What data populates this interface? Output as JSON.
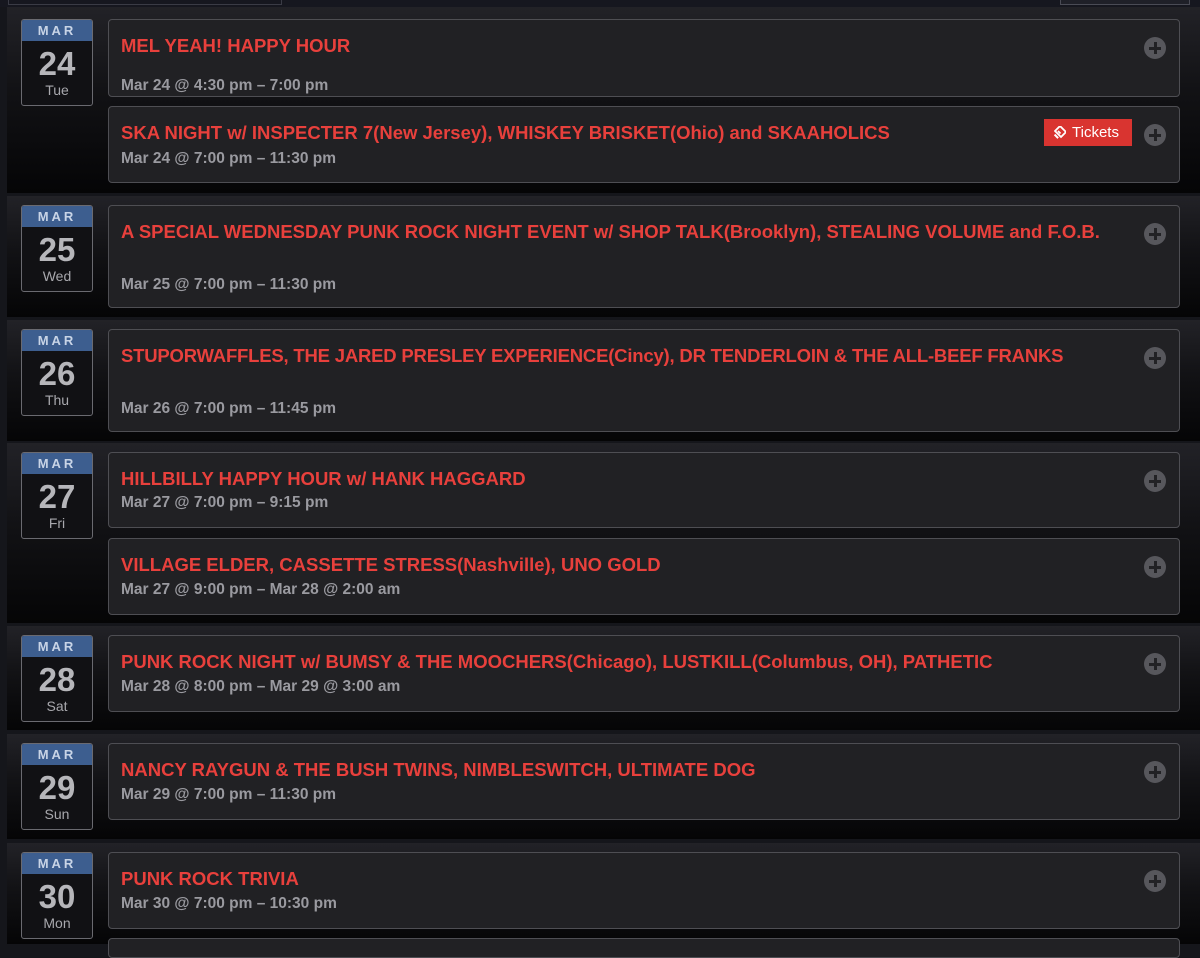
{
  "tickets_label": "Tickets",
  "colors": {
    "title": "#e8403c",
    "month_header": "#3d5e8f",
    "tickets_button": "#d93430"
  },
  "days": [
    {
      "month": "MAR",
      "day": "24",
      "weekday": "Tue",
      "events": [
        {
          "title": "MEL YEAH! HAPPY HOUR",
          "time": "Mar 24 @ 4:30 pm – 7:00 pm"
        },
        {
          "title": "SKA NIGHT w/ INSPECTER 7(New Jersey), WHISKEY BRISKET(Ohio) and SKAAHOLICS",
          "time": "Mar 24 @ 7:00 pm – 11:30 pm"
        }
      ]
    },
    {
      "month": "MAR",
      "day": "25",
      "weekday": "Wed",
      "events": [
        {
          "title": "A SPECIAL WEDNESDAY PUNK ROCK NIGHT EVENT w/ SHOP TALK(Brooklyn), STEALING VOLUME and F.O.B.",
          "time": "Mar 25 @ 7:00 pm – 11:30 pm"
        }
      ]
    },
    {
      "month": "MAR",
      "day": "26",
      "weekday": "Thu",
      "events": [
        {
          "title": "STUPORWAFFLES, THE JARED PRESLEY EXPERIENCE(Cincy), DR TENDERLOIN & THE ALL-BEEF FRANKS",
          "time": "Mar 26 @ 7:00 pm – 11:45 pm"
        }
      ]
    },
    {
      "month": "MAR",
      "day": "27",
      "weekday": "Fri",
      "events": [
        {
          "title": "HILLBILLY HAPPY HOUR w/ HANK HAGGARD",
          "time": "Mar 27 @ 7:00 pm – 9:15 pm"
        },
        {
          "title": "VILLAGE ELDER, CASSETTE STRESS(Nashville), UNO GOLD",
          "time": "Mar 27 @ 9:00 pm – Mar 28 @ 2:00 am"
        }
      ]
    },
    {
      "month": "MAR",
      "day": "28",
      "weekday": "Sat",
      "events": [
        {
          "title": "PUNK ROCK NIGHT w/ BUMSY & THE MOOCHERS(Chicago), LUSTKILL(Columbus, OH), PATHETIC",
          "time": "Mar 28 @ 8:00 pm – Mar 29 @ 3:00 am"
        }
      ]
    },
    {
      "month": "MAR",
      "day": "29",
      "weekday": "Sun",
      "events": [
        {
          "title": "NANCY RAYGUN & THE BUSH TWINS, NIMBLESWITCH, ULTIMATE DOG",
          "time": "Mar 29 @ 7:00 pm – 11:30 pm"
        }
      ]
    },
    {
      "month": "MAR",
      "day": "30",
      "weekday": "Mon",
      "events": [
        {
          "title": "PUNK ROCK TRIVIA",
          "time": "Mar 30 @ 7:00 pm – 10:30 pm"
        }
      ]
    }
  ]
}
